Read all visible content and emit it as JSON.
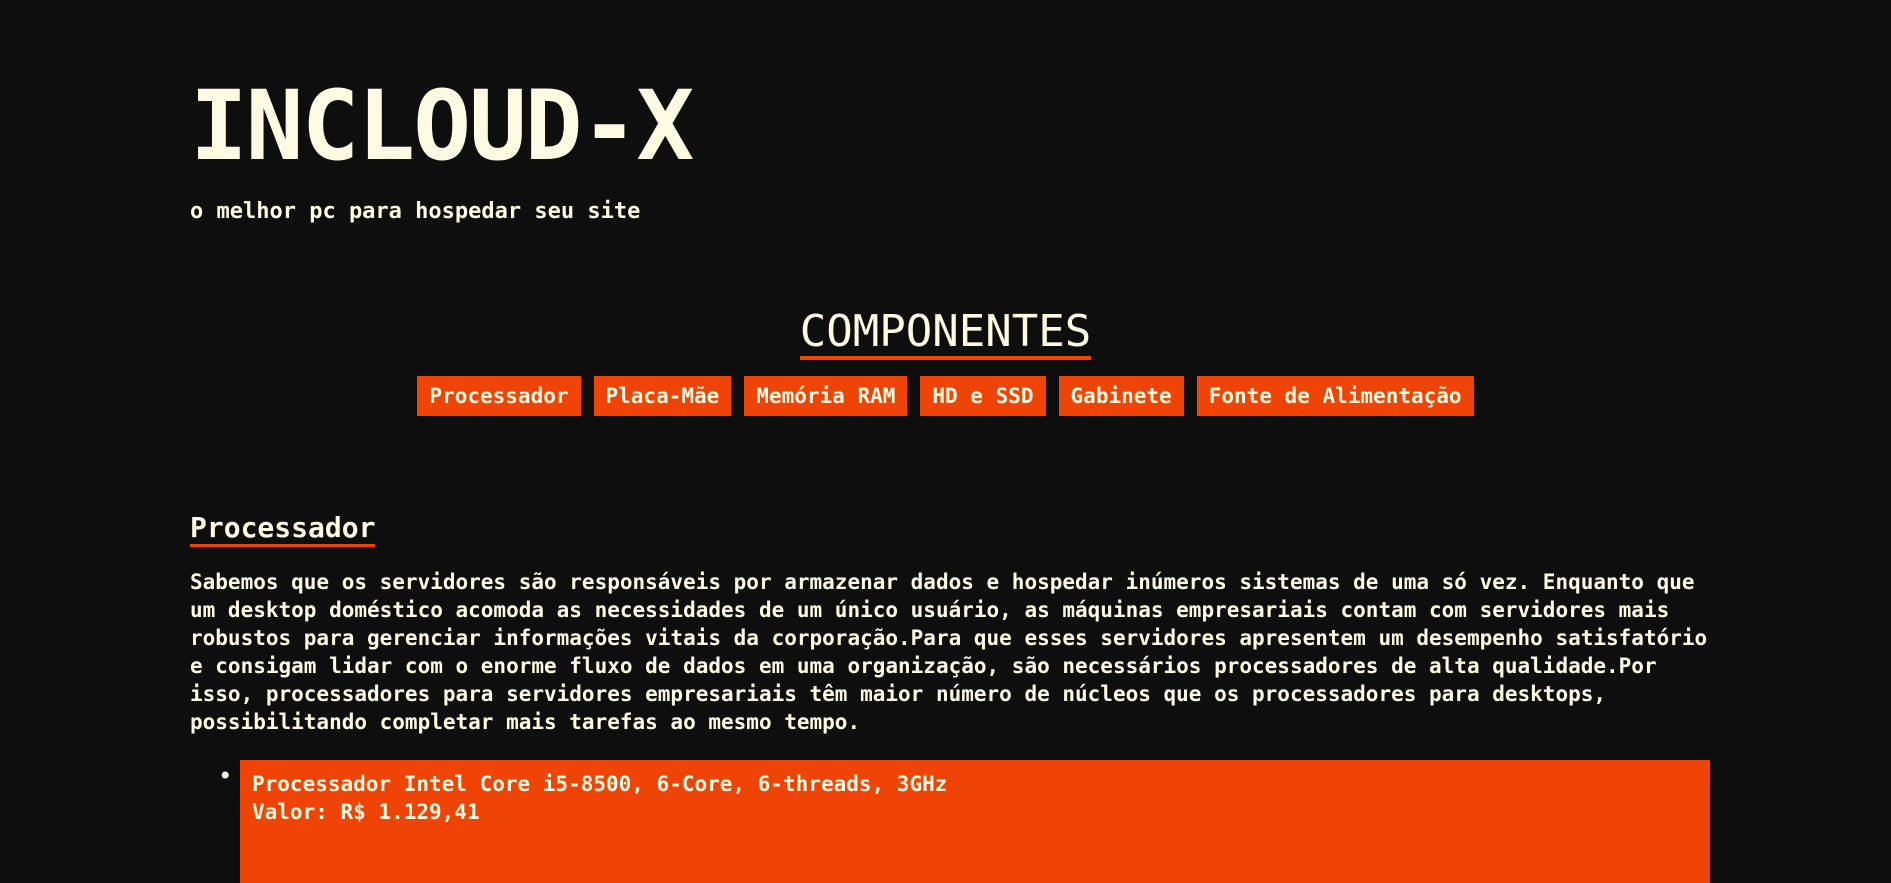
{
  "header": {
    "title": "INCLOUD-X",
    "tagline": "o melhor pc para hospedar seu site"
  },
  "components": {
    "heading": "COMPONENTES",
    "nav": [
      {
        "label": "Processador"
      },
      {
        "label": "Placa-Mãe"
      },
      {
        "label": "Memória RAM"
      },
      {
        "label": "HD e SSD"
      },
      {
        "label": "Gabinete"
      },
      {
        "label": "Fonte de Alimentação"
      }
    ]
  },
  "section": {
    "title": "Processador",
    "text": "Sabemos que os servidores são responsáveis por armazenar dados e hospedar inúmeros sistemas de uma só vez. Enquanto que um desktop doméstico acomoda as necessidades de um único usuário, as máquinas empresariais contam com servidores mais robustos para gerenciar informações vitais da corporação.Para que esses servidores apresentem um desempenho satisfatório e consigam lidar com o enorme fluxo de dados em uma organização, são necessários processadores de alta qualidade.Por isso, processadores para servidores empresariais têm maior número de núcleos que os processadores para desktops, possibilitando completar mais tarefas ao mesmo tempo.",
    "products": [
      {
        "name": "Processador Intel Core i5-8500, 6-Core, 6-threads, 3GHz",
        "price_label": "Valor:",
        "price": "R$ 1.129,41"
      }
    ]
  },
  "colors": {
    "background": "#0e0e0e",
    "text": "#fffbe3",
    "accent": "#f04406"
  }
}
